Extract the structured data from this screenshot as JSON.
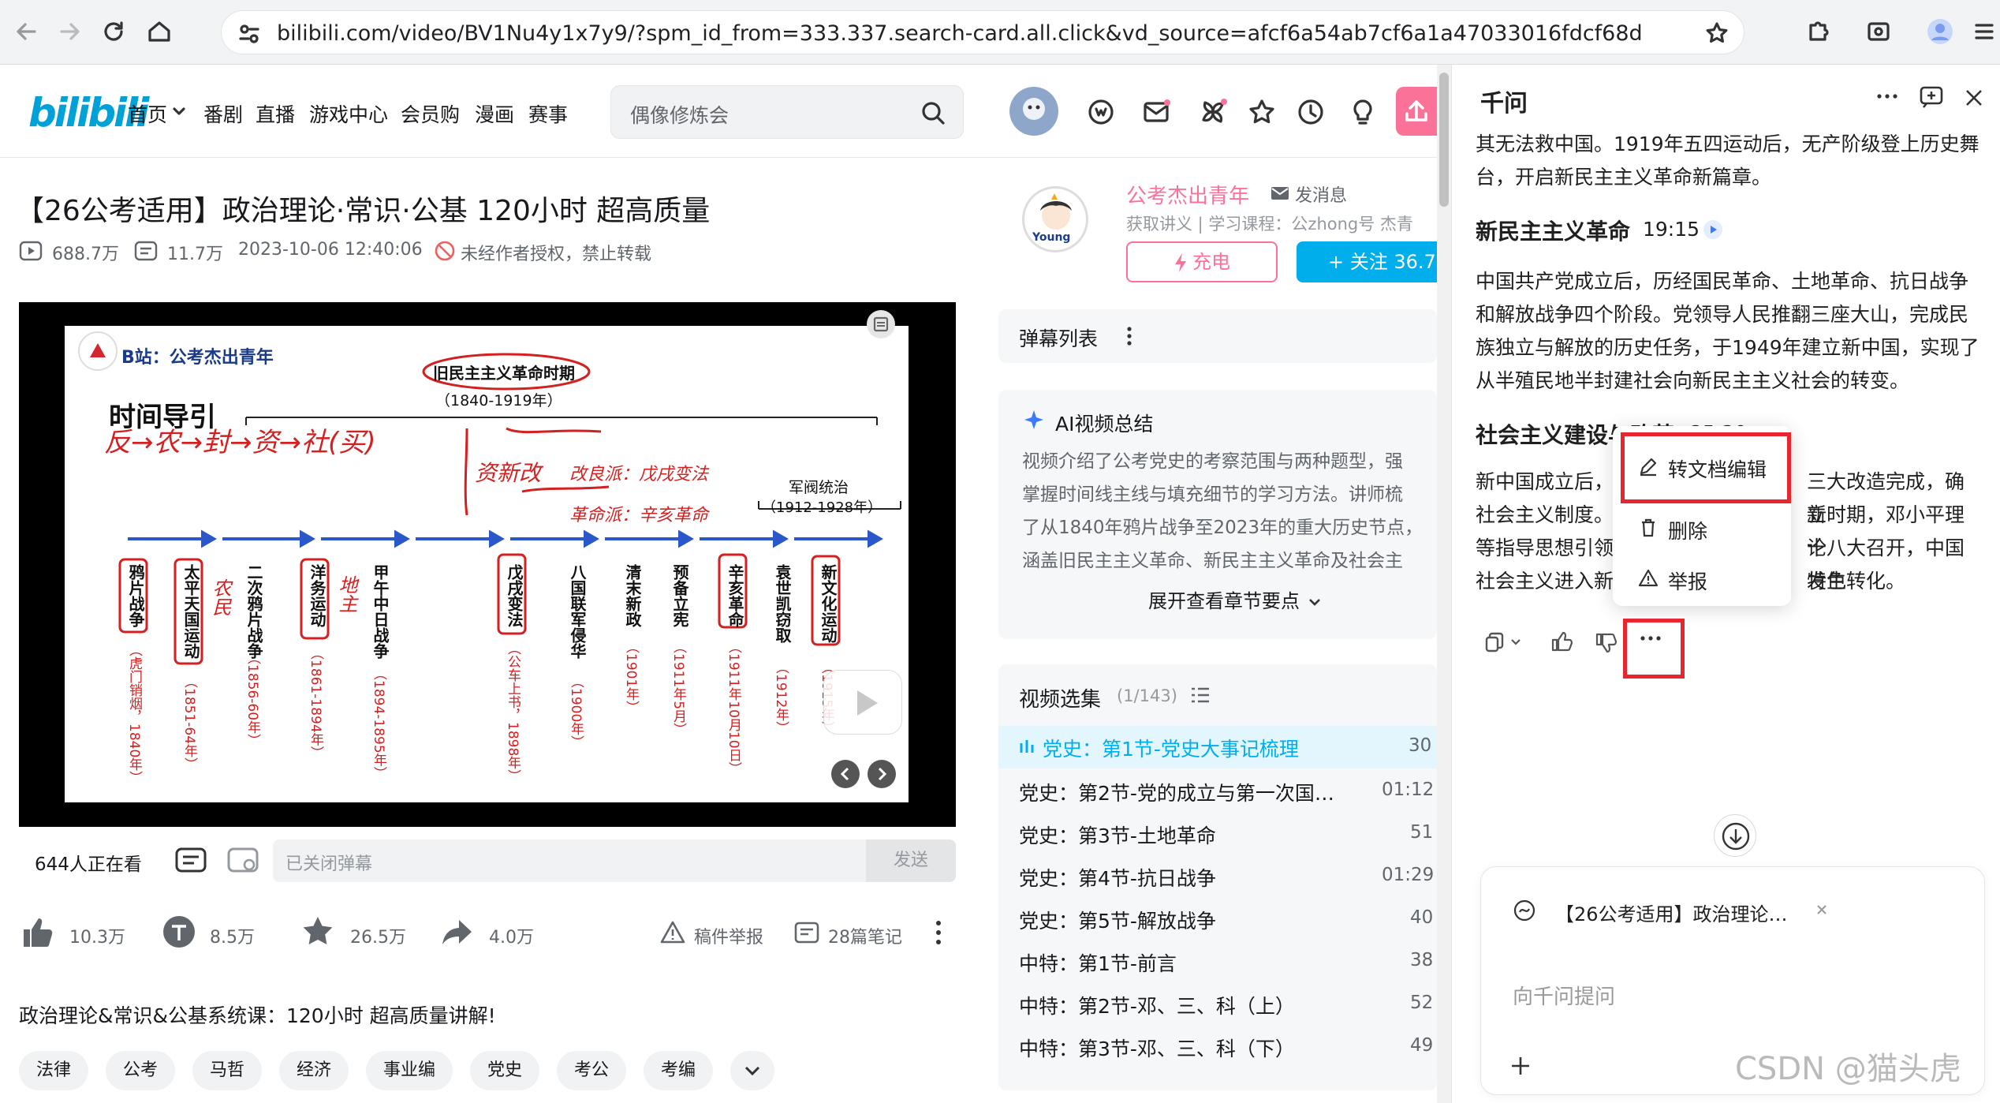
{
  "browser": {
    "url": "bilibili.com/video/BV1Nu4y1x7y9/?spm_id_from=333.337.search-card.all.click&vd_source=afcf6a54ab7cf6a1a47033016fdcf68d"
  },
  "header": {
    "logo": "bilibili",
    "nav": [
      "首页",
      "番剧",
      "直播",
      "游戏中心",
      "会员购",
      "漫画",
      "赛事"
    ],
    "search_placeholder": "偶像修炼会"
  },
  "video": {
    "title": "【26公考适用】政治理论·常识·公基 120小时 超高质量",
    "views": "688.7万",
    "danmaku_count": "11.7万",
    "date": "2023-10-06 12:40:06",
    "copyright": "未经作者授权，禁止转载"
  },
  "slide": {
    "brand": "B站：公考杰出青年",
    "heading": "时间导引",
    "period1": "旧民主主义革命时期",
    "period1_years": "（1840-1919年）",
    "period2": "军阀统治",
    "period2_years": "（1912-1928年）",
    "events": [
      {
        "name": "鸦片战争",
        "year": "（虎门销烟，1840年）"
      },
      {
        "name": "太平天国运动",
        "year": "（1851-64年）"
      },
      {
        "name": "二次鸦片战争",
        "year": "（1856-60年）"
      },
      {
        "name": "洋务运动",
        "year": "（1861-1894年）"
      },
      {
        "name": "甲午中日战争",
        "year": "（1894-1895年）"
      },
      {
        "name": "戊戌变法",
        "year": "（公车上书，1898年）"
      },
      {
        "name": "八国联军侵华",
        "year": "（1900年）"
      },
      {
        "name": "清末新政",
        "year": "（1901年）"
      },
      {
        "name": "预备立宪",
        "year": "（1911年5月）"
      },
      {
        "name": "辛亥革命",
        "year": "（1911年10月10日）"
      },
      {
        "name": "袁世凯窃取",
        "year": "（1912年）"
      },
      {
        "name": "新文化运动",
        "year": "（1915年）"
      }
    ],
    "handwriting1": "反→农→封→资→社(买)",
    "handwriting2": "资新改",
    "handwriting3": "改良派：戊戌变法",
    "handwriting4": "革命派：辛亥革命",
    "handwriting5": "农民",
    "handwriting6": "地主"
  },
  "player": {
    "online": "644人正在看",
    "danmaku_placeholder": "已关闭弹幕",
    "send": "发送"
  },
  "actions": {
    "like": "10.3万",
    "coin": "8.5万",
    "favorite": "26.5万",
    "share": "4.0万",
    "report": "稿件举报",
    "notes": "28篇笔记"
  },
  "description": "政治理论&常识&公基系统课：120小时 超高质量讲解!",
  "tags": [
    "法律",
    "公考",
    "马哲",
    "经济",
    "事业编",
    "党史",
    "考公",
    "考编"
  ],
  "uploader": {
    "name": "公考杰出青年",
    "message": "发消息",
    "desc": "获取讲义 | 学习课程：公zhong号 杰青",
    "charge": "充电",
    "follow": "+ 关注 36.7"
  },
  "danmaku_list": "弹幕列表",
  "ai_summary": {
    "title": "AI视频总结",
    "text": [
      "视频介绍了公考党史的考察范围与两种题型，强",
      "掌握时间线主线与填充细节的学习方法。讲师梳",
      "了从1840年鸦片战争至2023年的重大历史节点，",
      "涵盖旧民主主义革命、新民主主义革命及社会主"
    ],
    "expand": "展开查看章节要点"
  },
  "episodes": {
    "title": "视频选集",
    "count": "(1/143)",
    "items": [
      {
        "title": "党史：第1节-党史大事记梳理",
        "duration": "30",
        "active": true
      },
      {
        "title": "党史：第2节-党的成立与第一次国…",
        "duration": "01:12"
      },
      {
        "title": "党史：第3节-土地革命",
        "duration": "51"
      },
      {
        "title": "党史：第4节-抗日战争",
        "duration": "01:29"
      },
      {
        "title": "党史：第5节-解放战争",
        "duration": "40"
      },
      {
        "title": "中特：第1节-前言",
        "duration": "38"
      },
      {
        "title": "中特：第2节-邓、三、科（上）",
        "duration": "52"
      },
      {
        "title": "中特：第3节-邓、三、科（下）",
        "duration": "49"
      }
    ]
  },
  "qianwen": {
    "title": "千问",
    "para0": "其无法救中国。1919年五四运动后，无产阶级登上历史舞台，开启新民主主义革命新篇章。",
    "section1": "新民主主义革命",
    "section1_time": "19:15",
    "para1": "中国共产党成立后，历经国民革命、土地革命、抗日战争和解放战争四个阶段。党领导人民推翻三座大山，完成民族独立与解放的历史任务，于1949年建立新中国，实现了从半殖民地半封建社会向新民主主义社会的转变。",
    "section2": "社会主义建设与改革",
    "section2_time": "25:30",
    "para2_l1a": "新中国成立后，",
    "para2_l1b": "三大改造完成，确立",
    "para2_l2a": "社会主义制度。",
    "para2_l2b": "新时期，邓小平理论",
    "para2_l3a": "等指导思想引领",
    "para2_l3b": "十八大召开，中国特色",
    "para2_l4a": "社会主义进入新",
    "para2_l4b": "发生转化。",
    "menu": [
      "转文档编辑",
      "删除",
      "举报"
    ],
    "attachment": "【26公考适用】政治理论…",
    "input_placeholder": "向千问提问"
  },
  "watermark": "CSDN @猫头虎"
}
